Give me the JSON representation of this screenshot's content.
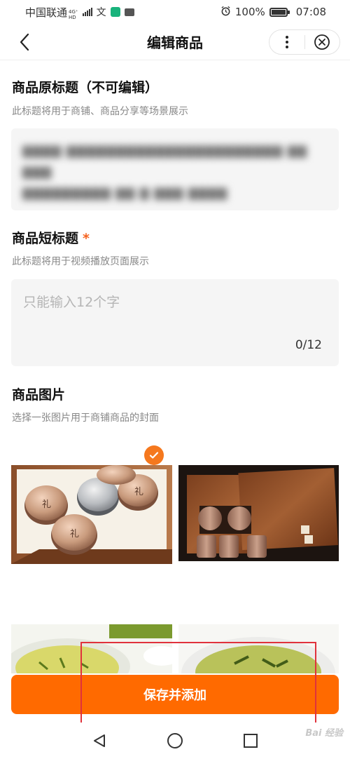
{
  "status_bar": {
    "carrier": "中国联通",
    "network": "4G⁺",
    "network_sub": "HD",
    "battery_percent": "100%",
    "time": "07:08",
    "icons": [
      "signal-icon",
      "translate-icon",
      "app-icon",
      "briefcase-icon",
      "alarm-icon",
      "battery-icon"
    ]
  },
  "nav": {
    "title": "编辑商品",
    "back_icon": "chevron-left-icon",
    "more_icon": "more-vertical-icon",
    "close_icon": "close-circle-icon"
  },
  "original_title": {
    "heading": "商品原标题（不可编辑）",
    "description": "此标题将用于商铺、商品分享等场景展示",
    "value_line1": "▇▇▇▇ ▇▇▇▇▇▇▇▇▇▇▇▇▇▇▇▇▇▇▇▇▇▇ ▇▇ ▇▇▇",
    "value_line2": "▇▇▇▇▇▇▇▇▇ ▇▇ ▇ ▇▇▇ ▇▇▇▇"
  },
  "short_title": {
    "heading": "商品短标题",
    "required_mark": "*",
    "description": "此标题将用于视频播放页面展示",
    "placeholder": "只能输入12个字",
    "counter": "0/12"
  },
  "images": {
    "heading": "商品图片",
    "description": "选择一张图片用于商铺商品的封面",
    "selected_index": 0,
    "tiles": [
      "tea-tins-in-tray",
      "tea-gift-box",
      "green-tea-cup-1",
      "green-tea-cup-2"
    ]
  },
  "actions": {
    "save_label": "保存并添加"
  },
  "system_nav": {
    "icons": [
      "back-triangle-icon",
      "home-circle-icon",
      "recents-square-icon"
    ]
  },
  "watermark": "Bai 经验",
  "colors": {
    "accent": "#ff6a00",
    "check": "#f5781e",
    "highlight": "#e0323c"
  }
}
